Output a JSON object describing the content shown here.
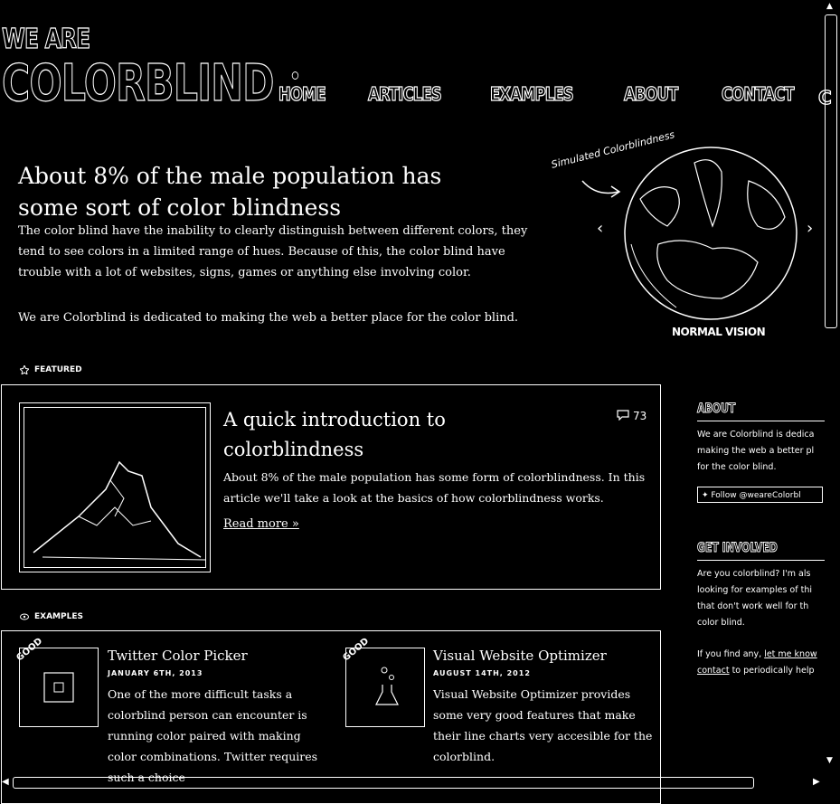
{
  "logo": {
    "line1": "WE ARE",
    "line2": "COLORBLIND"
  },
  "nav": {
    "items": [
      "HOME",
      "ARTICLES",
      "EXAMPLES",
      "ABOUT",
      "CONTACT"
    ],
    "clipped": "C"
  },
  "hero": {
    "title": "About 8% of the male population has some sort of color blindness",
    "paragraph1": "The color blind have the inability to clearly distinguish between different colors, they tend to see colors in a limited range of hues. Because of this, the color blind have trouble with a lot of websites, signs, games or anything else involving color.",
    "paragraph2": "We are Colorblind is dedicated to making the web a better place for the color blind.",
    "annotation": "Simulated Colorblindness",
    "prev": "‹",
    "next": "›",
    "caption": "NORMAL VISION"
  },
  "featured": {
    "label": "FEATURED",
    "title": "A quick introduction to colorblindness",
    "comments": "73",
    "excerpt": "About 8% of the male population has some form of colorblindness. In this article we'll take a look at the basics of how colorblindness works.",
    "read_more": "Read more »"
  },
  "examples": {
    "label": "EXAMPLES",
    "items": [
      {
        "badge": "GOOD",
        "title": "Twitter Color Picker",
        "date": "JANUARY 6TH, 2013",
        "desc": "One of the more difficult tasks a colorblind person can encounter is running color paired with making color combinations. Twitter requires such a choice"
      },
      {
        "badge": "GOOD",
        "title": "Visual Website Optimizer",
        "date": "AUGUST 14TH, 2012",
        "desc": "Visual Website Optimizer provides some very good features that make their line charts very accesible for the colorblind."
      }
    ]
  },
  "sidebar": {
    "about_heading": "ABOUT",
    "about_lines": [
      "We are Colorblind is dedica",
      "making the web a better pl",
      "for the color blind."
    ],
    "follow": "Follow @weareColorbl",
    "involved_heading": "GET INVOLVED",
    "involved_lines": [
      "Are you colorblind? I'm als",
      "looking for examples of thi",
      "that don't work well for th",
      "color blind."
    ],
    "involved_line5a": "If you find any, ",
    "involved_link": "let me know",
    "involved_line6a": "",
    "involved_link2": "contact",
    "involved_line6b": " to periodically help"
  },
  "scroll": {
    "up": "▲",
    "down": "▼",
    "left": "◀",
    "right": "▶"
  }
}
